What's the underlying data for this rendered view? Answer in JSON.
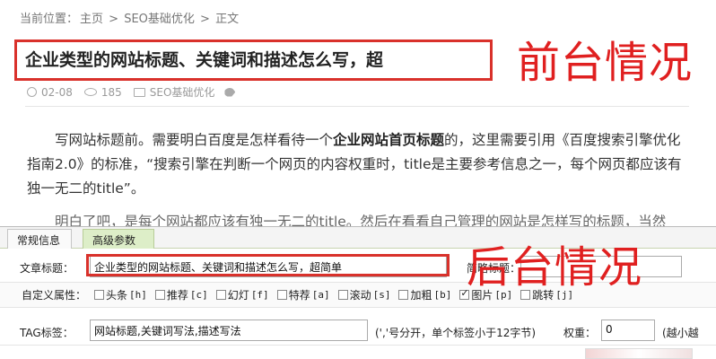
{
  "breadcrumb": {
    "prefix": "当前位置：",
    "home": "主页",
    "sep": " > ",
    "category": "SEO基础优化",
    "current": "正文"
  },
  "article": {
    "title": "企业类型的网站标题、关键词和描述怎么写，超",
    "date": "02-08",
    "views": "185",
    "category": "SEO基础优化",
    "para1_a": "写网站标题前。需要明白百度是怎样看待一个",
    "para1_bold": "企业网站首页标题",
    "para1_b": "的，这里需要引用《百度搜索引擎优化指南2.0》的标准，“搜索引擎在判断一个网页的内容权重时，title是主要参考信息之一，每个网页都应该有独一无二的title”。",
    "para2": "明白了吧，是每个网站都应该有独一无二的title。然后在看看自己管理的网站是怎样写的标题，当然"
  },
  "annotations": {
    "front": "前台情况",
    "back": "后台情况",
    "color": "#e02020"
  },
  "backend": {
    "tabs": [
      "常规信息",
      "高级参数"
    ],
    "title_label": "文章标题：",
    "title_value": "企业类型的网站标题、关键词和描述怎么写，超简单",
    "short_title_label": "简略标题：",
    "short_title_value": "",
    "attr_label": "自定义属性：",
    "attributes": [
      {
        "name": "头条",
        "code": "[h]",
        "checked": false
      },
      {
        "name": "推荐",
        "code": "[c]",
        "checked": false
      },
      {
        "name": "幻灯",
        "code": "[f]",
        "checked": false
      },
      {
        "name": "特荐",
        "code": "[a]",
        "checked": false
      },
      {
        "name": "滚动",
        "code": "[s]",
        "checked": false
      },
      {
        "name": "加粗",
        "code": "[b]",
        "checked": false
      },
      {
        "name": "图片",
        "code": "[p]",
        "checked": true
      },
      {
        "name": "跳转",
        "code": "[j]",
        "checked": false
      }
    ],
    "tag_label": "TAG标签：",
    "tag_value": "网站标题,关键词写法,描述写法",
    "tag_hint": "(','号分开，单个标签小于12字节)",
    "weight_label": "权重：",
    "weight_value": "0",
    "weight_hint": "(越小越"
  }
}
